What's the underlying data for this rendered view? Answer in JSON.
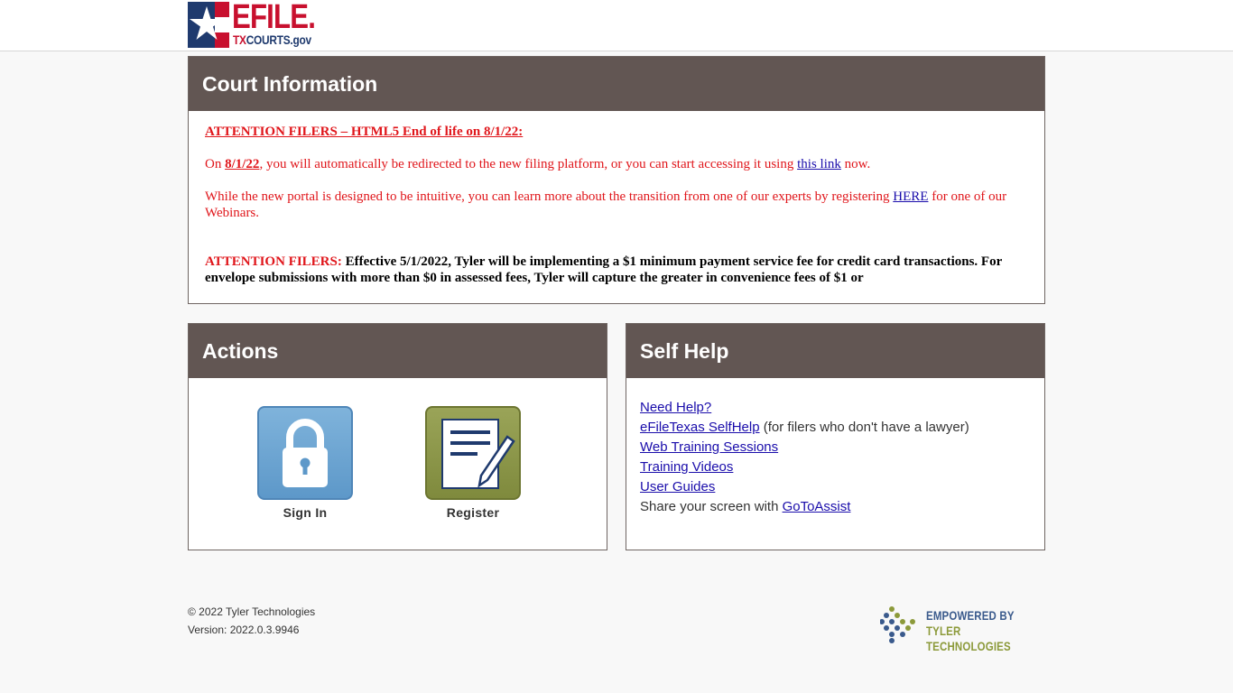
{
  "header": {
    "logo_main": "EFILE.",
    "logo_sub_tx": "TX",
    "logo_sub_rest": "COURTS.gov"
  },
  "court_info": {
    "title": "Court Information",
    "notice1_heading": "ATTENTION FILERS – HTML5 End of life on 8/1/22:",
    "notice1_p1_pre": "On ",
    "notice1_p1_date": "8/1/22",
    "notice1_p1_mid": ", you will automatically be redirected to the new filing platform, or you can start accessing it using ",
    "notice1_p1_link": "this link",
    "notice1_p1_post": " now.",
    "notice1_p2_pre": "While the new portal is designed to be intuitive, you can learn more about the transition from one of our experts by registering ",
    "notice1_p2_link": "HERE",
    "notice1_p2_post": " for one of our Webinars.",
    "notice2_label": "ATTENTION FILERS:",
    "notice2_text": " Effective 5/1/2022, Tyler will be implementing a $1 minimum payment service fee for credit card transactions. For envelope submissions with more than $0 in assessed fees, Tyler will capture the greater in convenience fees of $1 or"
  },
  "actions": {
    "title": "Actions",
    "sign_in_label": "Sign In",
    "register_label": "Register",
    "sign_in_icon": "lock-icon",
    "register_icon": "document-pencil-icon"
  },
  "self_help": {
    "title": "Self Help",
    "need_help": "Need Help?",
    "selfhelp_link": "eFileTexas SelfHelp",
    "selfhelp_note": " (for filers who don't have a lawyer)",
    "web_training": "Web Training Sessions",
    "training_videos": "Training Videos",
    "user_guides": "User Guides",
    "share_text": "Share your screen with ",
    "gotoassist": "GoToAssist"
  },
  "footer": {
    "copyright": "© 2022 Tyler Technologies",
    "version": "Version: 2022.0.3.9946",
    "empowered_line1": "EMPOWERED BY",
    "empowered_line2": "TYLER TECHNOLOGIES"
  },
  "colors": {
    "panel_header": "#625653",
    "alert_red": "#e0161b",
    "link_blue": "#1a0dab",
    "brand_navy": "#1f3a6e",
    "brand_red": "#c8102e"
  }
}
